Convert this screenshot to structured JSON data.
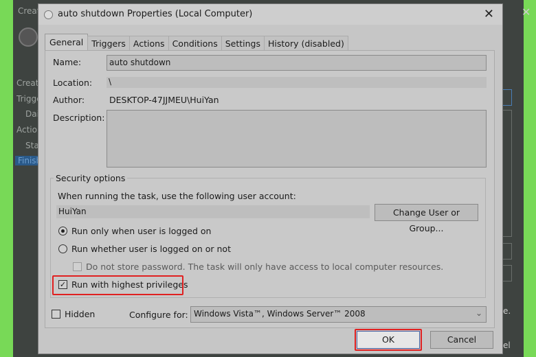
{
  "background": {
    "left_items": [
      "Creat",
      "Creat",
      "Trigge",
      "Dai",
      "Actio",
      "Sta",
      "Finish"
    ],
    "right_items": [
      "e.",
      "el"
    ]
  },
  "dialog": {
    "title": "auto shutdown Properties (Local Computer)",
    "close": "✕",
    "tabs": [
      "General",
      "Triggers",
      "Actions",
      "Conditions",
      "Settings",
      "History (disabled)"
    ],
    "active_tab": "General",
    "general": {
      "name_label": "Name:",
      "name_value": "auto shutdown",
      "location_label": "Location:",
      "location_value": "\\",
      "author_label": "Author:",
      "author_value": "DESKTOP-47JJMEU\\HuiYan",
      "description_label": "Description:",
      "description_value": "",
      "security": {
        "title": "Security options",
        "account_label": "When running the task, use the following user account:",
        "account_value": "HuiYan",
        "change_button": "Change User or Group...",
        "radio_logged_on": "Run only when user is logged on",
        "radio_whether": "Run whether user is logged on or not",
        "selected_radio": "Run only when user is logged on",
        "no_store_password": "Do not store password.  The task will only have access to local computer resources.",
        "no_store_password_checked": false,
        "highest_privileges": "Run with highest privileges",
        "highest_privileges_checked": true
      },
      "hidden_label": "Hidden",
      "hidden_checked": false,
      "configure_label": "Configure for:",
      "configure_value": "Windows Vista™, Windows Server™ 2008"
    },
    "ok": "OK",
    "cancel": "Cancel",
    "highlight_color": "#e02020"
  }
}
